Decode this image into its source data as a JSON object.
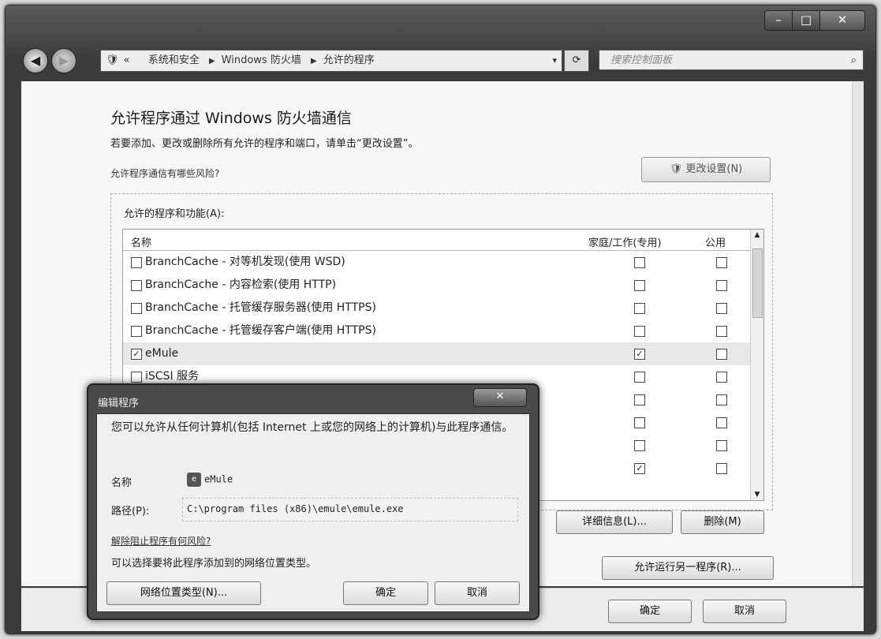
{
  "window": {
    "minimize": "–",
    "maximize": "□",
    "close": "✕"
  },
  "nav": {
    "back_icon": "◀",
    "forward_icon": "▶",
    "breadcrumb": [
      "系统和安全",
      "Windows 防火墙",
      "允许的程序"
    ],
    "overflow": "«",
    "dropdown_icon": "▾",
    "refresh_icon": "⟳",
    "search_placeholder": "搜索控制面板",
    "search_icon": "⌕"
  },
  "main": {
    "title": "允许程序通过 Windows 防火墙通信",
    "description": "若要添加、更改或删除所有允许的程序和端口，请单击“更改设置”。",
    "risk_link": "允许程序通信有哪些风险?",
    "change_settings_button": "更改设置(N)",
    "list_label": "允许的程序和功能(A):",
    "columns": {
      "name": "名称",
      "home": "家庭/工作(专用)",
      "public": "公用"
    },
    "rows": [
      {
        "name": "BranchCache - 对等机发现(使用 WSD)",
        "enabled": false,
        "home": false,
        "public": false,
        "selected": false
      },
      {
        "name": "BranchCache - 内容检索(使用 HTTP)",
        "enabled": false,
        "home": false,
        "public": false,
        "selected": false
      },
      {
        "name": "BranchCache - 托管缓存服务器(使用 HTTPS)",
        "enabled": false,
        "home": false,
        "public": false,
        "selected": false
      },
      {
        "name": "BranchCache - 托管缓存客户端(使用 HTTPS)",
        "enabled": false,
        "home": false,
        "public": false,
        "selected": false
      },
      {
        "name": "eMule",
        "enabled": true,
        "home": true,
        "public": false,
        "selected": true
      },
      {
        "name": "iSCSI 服务",
        "enabled": false,
        "home": false,
        "public": false,
        "selected": false
      },
      {
        "name": "",
        "enabled": false,
        "home": false,
        "public": false,
        "selected": false
      },
      {
        "name": "",
        "enabled": false,
        "home": false,
        "public": false,
        "selected": false
      },
      {
        "name": "",
        "enabled": false,
        "home": false,
        "public": false,
        "selected": false
      },
      {
        "name": "",
        "enabled": false,
        "home": true,
        "public": false,
        "selected": false
      }
    ],
    "details_button": "详细信息(L)...",
    "remove_button": "删除(M)",
    "allow_another_button": "允许运行另一程序(R)...",
    "ok_button": "确定",
    "cancel_button": "取消"
  },
  "dialog": {
    "title": "编辑程序",
    "close": "✕",
    "intro": "您可以允许从任何计算机(包括 Internet 上或您的网络上的计算机)与此程序通信。",
    "name_label": "名称",
    "name_value": "eMule",
    "app_icon": "eMule-icon",
    "path_label": "路径(P):",
    "path_value": "C:\\program files (x86)\\emule\\emule.exe",
    "block_risk_link": "解除阻止程序有何风险?",
    "hint": "可以选择要将此程序添加到的网络位置类型。",
    "network_types_button": "网络位置类型(N)...",
    "ok_button": "确定",
    "cancel_button": "取消"
  }
}
